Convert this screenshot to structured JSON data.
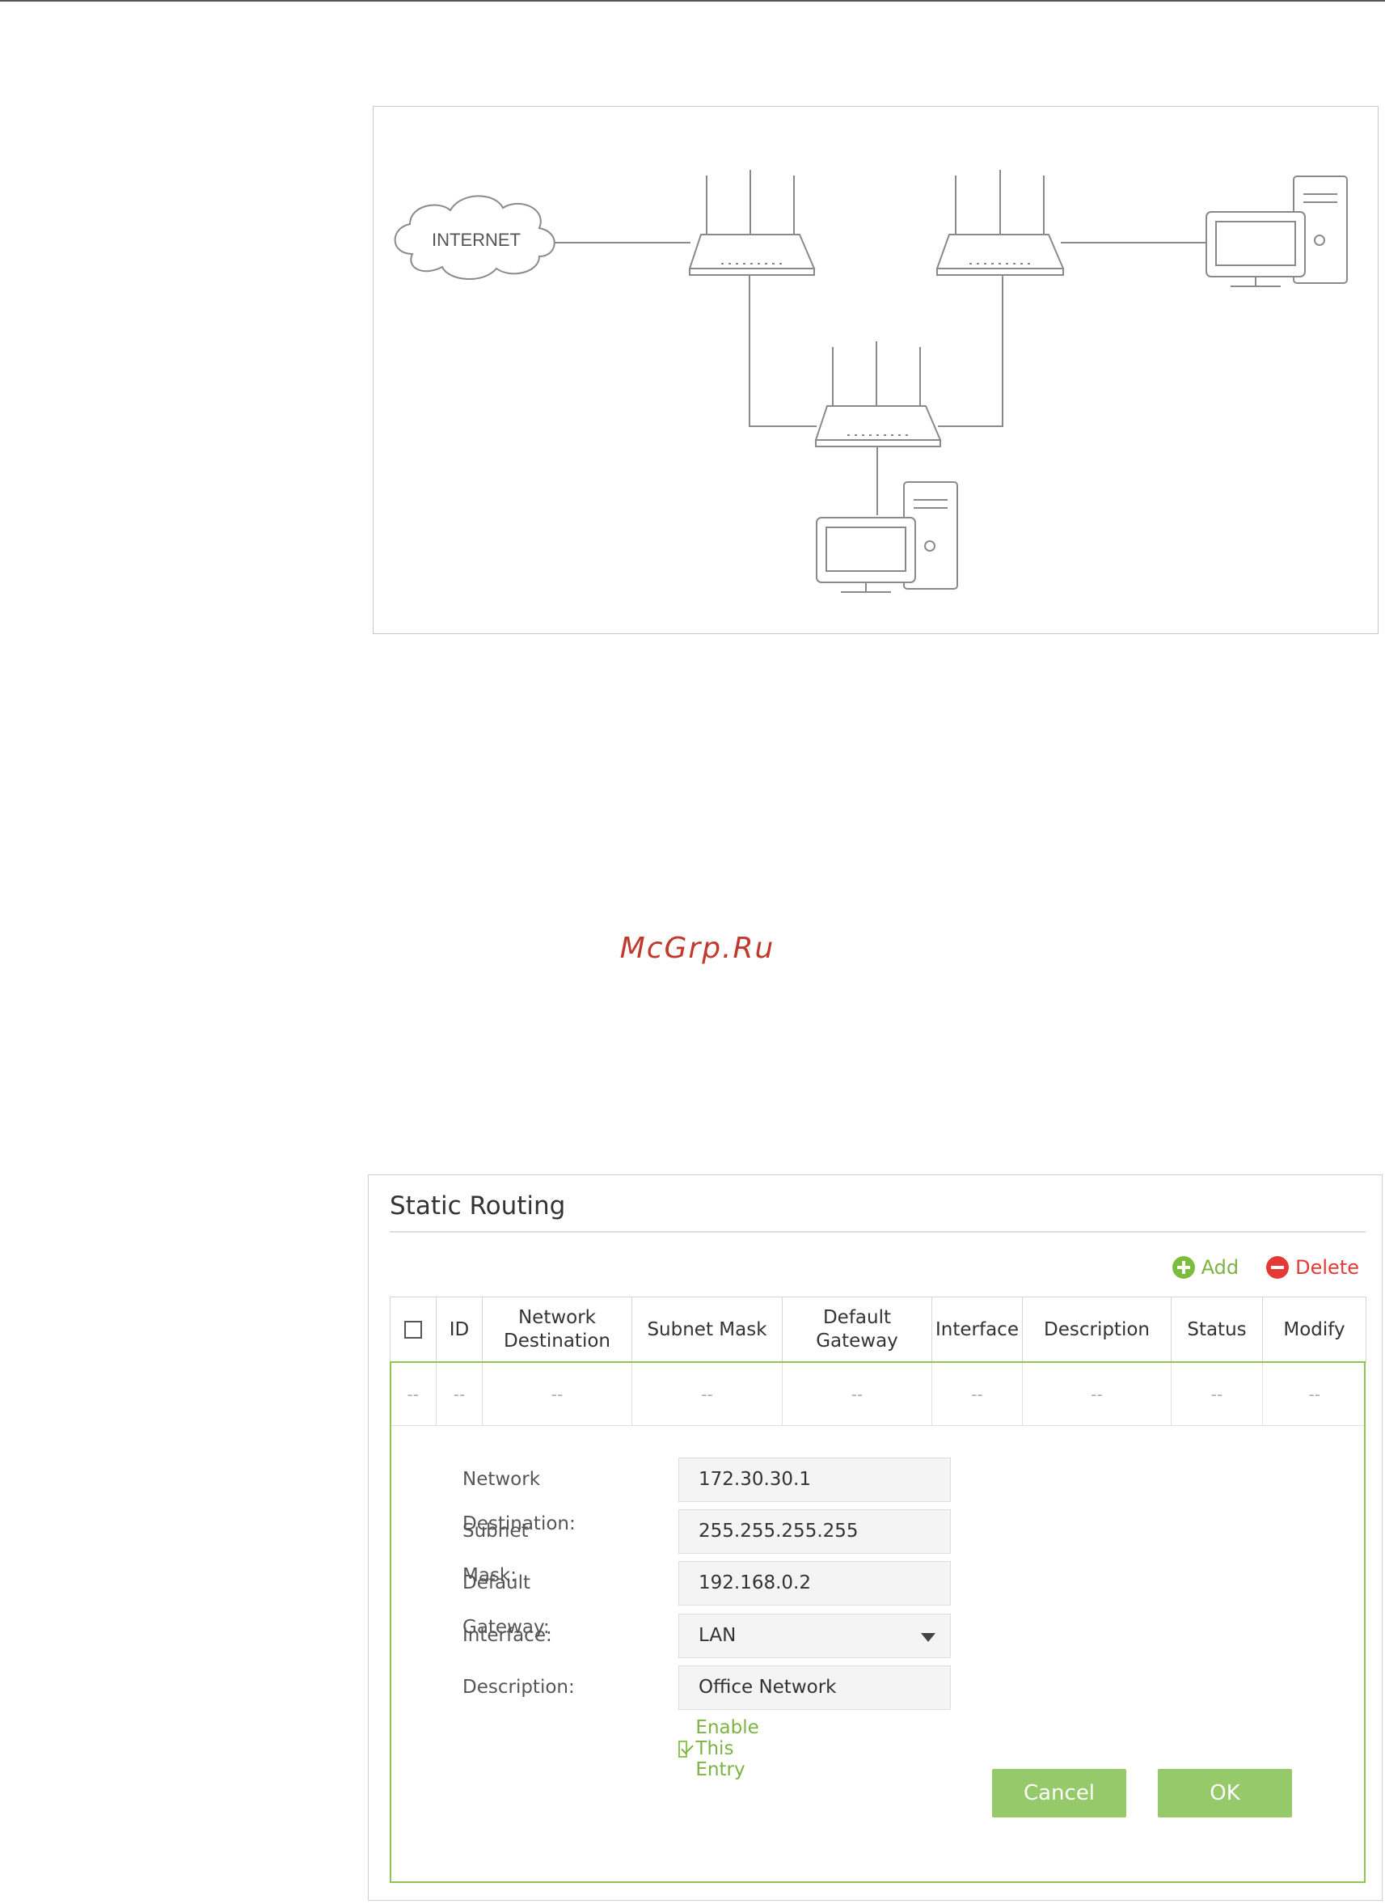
{
  "diagram": {
    "internet_label": "INTERNET"
  },
  "watermark": "McGrp.Ru",
  "panel": {
    "title": "Static Routing",
    "add_label": "Add",
    "delete_label": "Delete",
    "columns": [
      "ID",
      "Network Destination",
      "Subnet Mask",
      "Default Gateway",
      "Interface",
      "Description",
      "Status",
      "Modify"
    ],
    "empty_row": [
      "--",
      "--",
      "--",
      "--",
      "--",
      "--",
      "--",
      "--",
      "--"
    ]
  },
  "form": {
    "network_destination": {
      "label": "Network Destination:",
      "value": "172.30.30.1"
    },
    "subnet_mask": {
      "label": "Subnet Mask:",
      "value": "255.255.255.255"
    },
    "default_gateway": {
      "label": "Default Gateway:",
      "value": "192.168.0.2"
    },
    "interface": {
      "label": "Interface:",
      "value": "LAN"
    },
    "description": {
      "label": "Description:",
      "value": "Office Network"
    },
    "enable_label": "Enable This Entry",
    "cancel_label": "Cancel",
    "ok_label": "OK"
  },
  "colors": {
    "accent_green": "#8dc655",
    "delete_red": "#e53935",
    "watermark_red": "#c0392b"
  }
}
